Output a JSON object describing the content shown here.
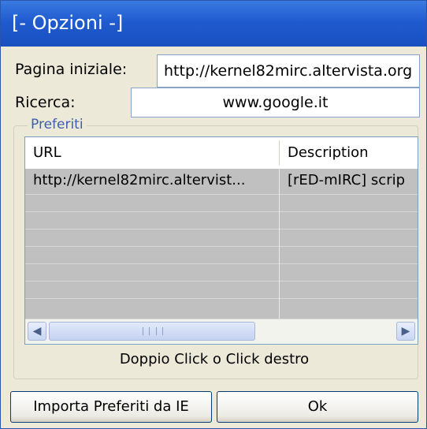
{
  "window": {
    "title": "[- Opzioni -]"
  },
  "form": {
    "start_page_label": "Pagina iniziale:",
    "start_page_value": "http://kernel82mirc.altervista.org",
    "search_label": "Ricerca:",
    "search_value": "www.google.it"
  },
  "favorites": {
    "group_label": "Preferiti",
    "columns": [
      "URL",
      "Description"
    ],
    "rows": [
      {
        "url": "http://kernel82mirc.altervist...",
        "description": "[rED-mIRC] scrip"
      }
    ]
  },
  "hint": "Doppio Click o Click destro",
  "buttons": {
    "import_label": "Importa Preferiti da IE",
    "ok_label": "Ok"
  },
  "icons": {
    "scroll_left": "left-arrow-icon",
    "scroll_right": "right-arrow-icon",
    "thumb_grip": "grip-icon"
  }
}
